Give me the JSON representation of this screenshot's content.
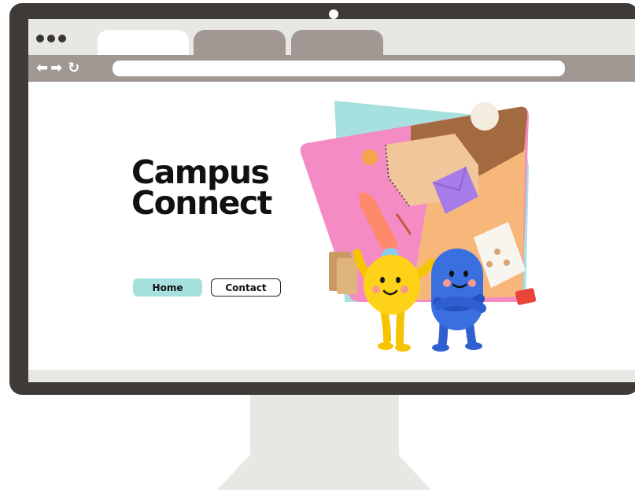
{
  "browser": {
    "tabs": [
      {
        "label": "",
        "active": true
      },
      {
        "label": "",
        "active": false
      },
      {
        "label": "",
        "active": false
      }
    ],
    "nav_icons": [
      "back-arrow-icon",
      "forward-arrow-icon",
      "reload-icon"
    ],
    "nav_glyphs": {
      "back": "⬅",
      "forward": "➡",
      "reload": "↻"
    },
    "url": ""
  },
  "page": {
    "title_line1": "Campus",
    "title_line2": "Connect",
    "nav": {
      "home_label": "Home",
      "contact_label": "Contact"
    },
    "illustration": "desk-flatlay-with-two-cartoon-characters"
  },
  "colors": {
    "monitor_frame": "#403a37",
    "browser_chrome": "#a29893",
    "tab_strip": "#e7e8e4",
    "home_button": "#a6e0df",
    "accent_pink": "#f48bc4",
    "accent_teal": "#a6e0df"
  }
}
